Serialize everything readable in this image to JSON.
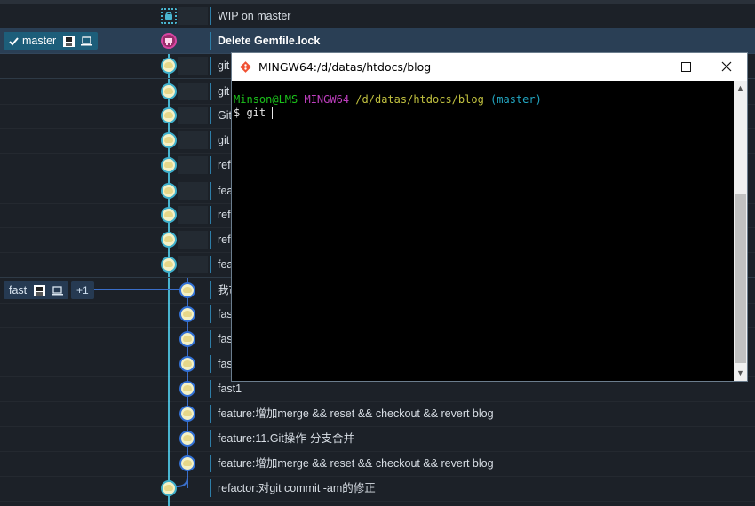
{
  "graph": {
    "wip_message": "WIP on master",
    "rows": [
      {
        "message": "WIP on master"
      },
      {
        "message": "Delete Gemfile.lock"
      },
      {
        "message": "git"
      },
      {
        "message": "git"
      },
      {
        "message": "Git"
      },
      {
        "message": "git"
      },
      {
        "message": "ref"
      },
      {
        "message": "featu"
      },
      {
        "message": "ref"
      },
      {
        "message": "ref"
      },
      {
        "message": "featu"
      },
      {
        "message": "我市"
      },
      {
        "message": "fas"
      },
      {
        "message": "fas"
      },
      {
        "message": "fas"
      },
      {
        "message": "fast1"
      },
      {
        "message": "feature:增加merge && reset && checkout && revert blog"
      },
      {
        "message": "feature:11.Git操作-分支合并"
      },
      {
        "message": "feature:增加merge && reset && checkout && revert blog"
      },
      {
        "message": "refactor:对git commit -am的修正"
      }
    ],
    "branches": {
      "master": {
        "label": "master"
      },
      "fast": {
        "label": "fast",
        "extra": "+1"
      }
    },
    "colors": {
      "lane1": "#48b4cf",
      "lane2": "#3a6ec9",
      "head": "#d845a2",
      "selected_row": "#2a3f55"
    }
  },
  "terminal": {
    "title": "MINGW64:/d/datas/htdocs/blog",
    "prompt_user": "Minson@LMS",
    "prompt_env": "MINGW64",
    "prompt_path": "/d/datas/htdocs/blog",
    "prompt_branch": "(master)",
    "input_line": "$ git ",
    "buttons": {
      "minimize": "—",
      "maximize": "☐",
      "close": "✕"
    }
  }
}
